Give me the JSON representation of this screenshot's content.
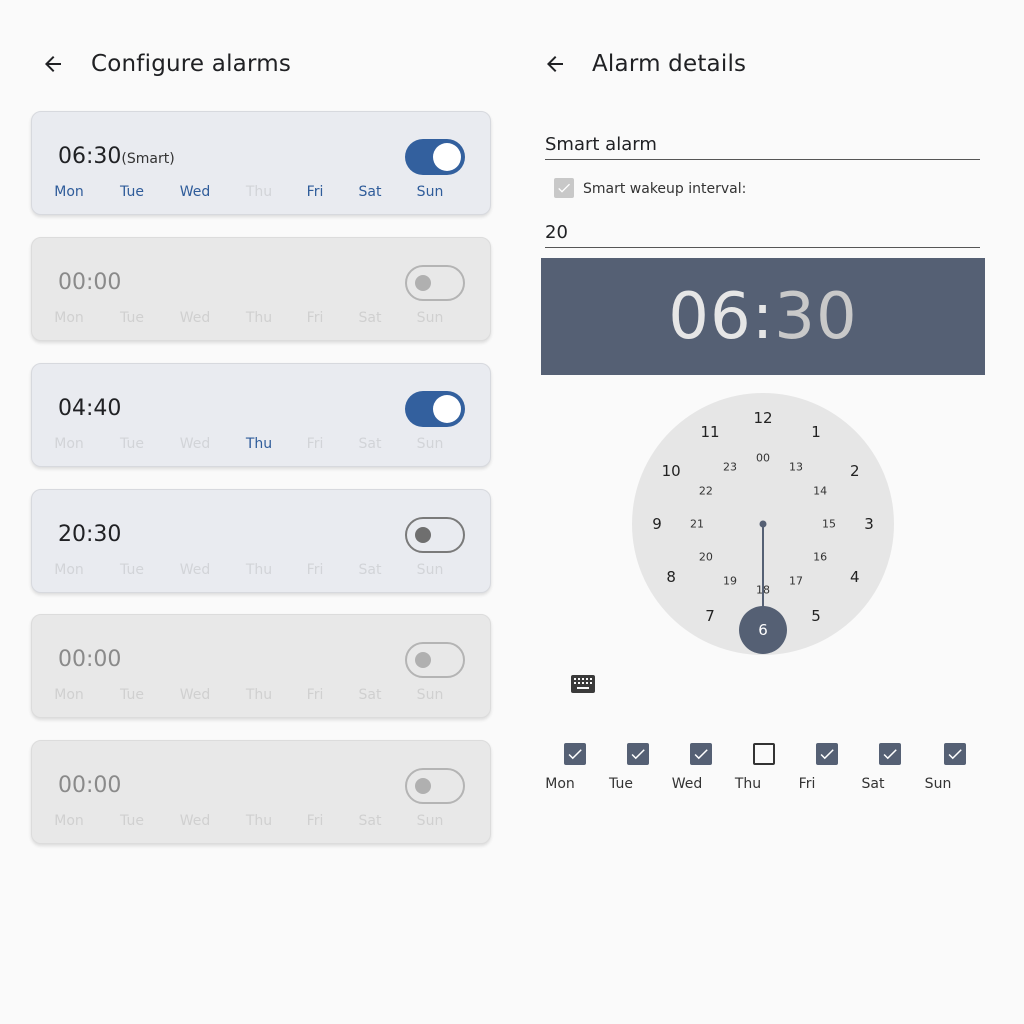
{
  "left": {
    "title": "Configure alarms",
    "alarms": [
      {
        "time": "06:30",
        "sub": "(Smart)",
        "enabled": true,
        "toggle": "on",
        "days": [
          {
            "label": "Mon",
            "on": true
          },
          {
            "label": "Tue",
            "on": true
          },
          {
            "label": "Wed",
            "on": true
          },
          {
            "label": "Thu",
            "on": false
          },
          {
            "label": "Fri",
            "on": true
          },
          {
            "label": "Sat",
            "on": true
          },
          {
            "label": "Sun",
            "on": true
          }
        ]
      },
      {
        "time": "00:00",
        "sub": "",
        "enabled": false,
        "toggle": "off",
        "days": [
          {
            "label": "Mon",
            "on": false
          },
          {
            "label": "Tue",
            "on": false
          },
          {
            "label": "Wed",
            "on": false
          },
          {
            "label": "Thu",
            "on": false
          },
          {
            "label": "Fri",
            "on": false
          },
          {
            "label": "Sat",
            "on": false
          },
          {
            "label": "Sun",
            "on": false
          }
        ]
      },
      {
        "time": "04:40",
        "sub": "",
        "enabled": true,
        "toggle": "on",
        "days": [
          {
            "label": "Mon",
            "on": false
          },
          {
            "label": "Tue",
            "on": false
          },
          {
            "label": "Wed",
            "on": false
          },
          {
            "label": "Thu",
            "on": true
          },
          {
            "label": "Fri",
            "on": false
          },
          {
            "label": "Sat",
            "on": false
          },
          {
            "label": "Sun",
            "on": false
          }
        ]
      },
      {
        "time": "20:30",
        "sub": "",
        "enabled": true,
        "toggle": "off",
        "days": [
          {
            "label": "Mon",
            "on": false
          },
          {
            "label": "Tue",
            "on": false
          },
          {
            "label": "Wed",
            "on": false
          },
          {
            "label": "Thu",
            "on": false
          },
          {
            "label": "Fri",
            "on": false
          },
          {
            "label": "Sat",
            "on": false
          },
          {
            "label": "Sun",
            "on": false
          }
        ]
      },
      {
        "time": "00:00",
        "sub": "",
        "enabled": false,
        "toggle": "off",
        "days": [
          {
            "label": "Mon",
            "on": false
          },
          {
            "label": "Tue",
            "on": false
          },
          {
            "label": "Wed",
            "on": false
          },
          {
            "label": "Thu",
            "on": false
          },
          {
            "label": "Fri",
            "on": false
          },
          {
            "label": "Sat",
            "on": false
          },
          {
            "label": "Sun",
            "on": false
          }
        ]
      },
      {
        "time": "00:00",
        "sub": "",
        "enabled": false,
        "toggle": "off",
        "days": [
          {
            "label": "Mon",
            "on": false
          },
          {
            "label": "Tue",
            "on": false
          },
          {
            "label": "Wed",
            "on": false
          },
          {
            "label": "Thu",
            "on": false
          },
          {
            "label": "Fri",
            "on": false
          },
          {
            "label": "Sat",
            "on": false
          },
          {
            "label": "Sun",
            "on": false
          }
        ]
      }
    ]
  },
  "right": {
    "title": "Alarm details",
    "name_value": "Smart alarm",
    "smart_wakeup_label": "Smart wakeup interval:",
    "smart_wakeup_checked": true,
    "interval_value": "20",
    "header_hour": "06",
    "header_sep": ":",
    "header_minute": "30",
    "clock_outer": [
      "12",
      "1",
      "2",
      "3",
      "4",
      "5",
      "6",
      "7",
      "8",
      "9",
      "10",
      "11"
    ],
    "clock_inner": [
      "00",
      "13",
      "14",
      "15",
      "16",
      "17",
      "18",
      "19",
      "20",
      "21",
      "22",
      "23"
    ],
    "selected_hour": "6",
    "weekdays": [
      {
        "label": "Mon",
        "checked": true
      },
      {
        "label": "Tue",
        "checked": true
      },
      {
        "label": "Wed",
        "checked": true
      },
      {
        "label": "Thu",
        "checked": false
      },
      {
        "label": "Fri",
        "checked": true
      },
      {
        "label": "Sat",
        "checked": true
      },
      {
        "label": "Sun",
        "checked": true
      }
    ]
  },
  "icons": {
    "back": "arrow-left-icon",
    "keyboard": "keyboard-icon",
    "check": "check-icon"
  },
  "colors": {
    "accent": "#33609e",
    "header": "#556074",
    "clock_face": "#e6e6e6"
  }
}
